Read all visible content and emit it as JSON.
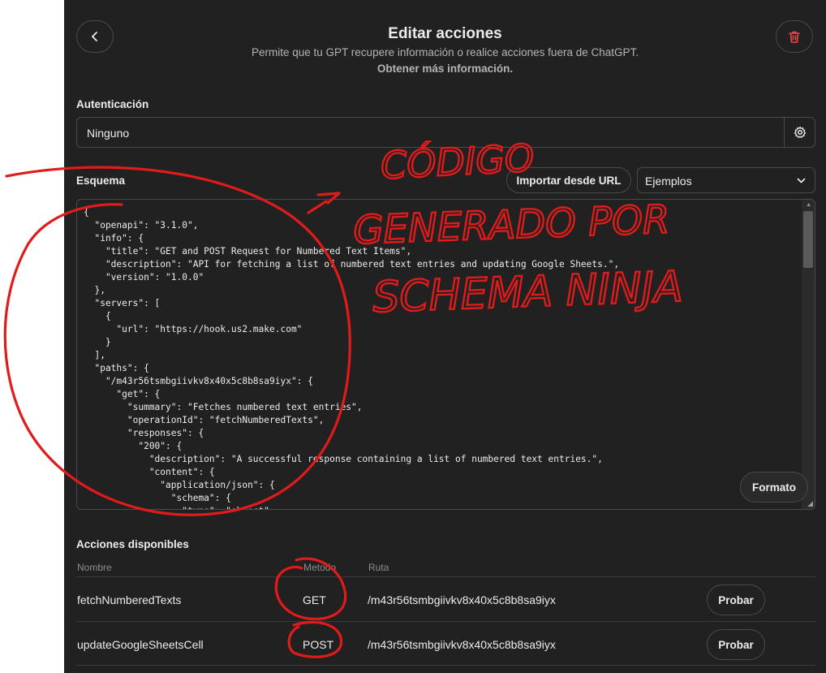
{
  "header": {
    "title": "Editar acciones",
    "subtitle": "Permite que tu GPT recupere información o realice acciones fuera de ChatGPT.",
    "link": "Obtener más información."
  },
  "auth": {
    "label": "Autenticación",
    "value": "Ninguno"
  },
  "schema": {
    "label": "Esquema",
    "import_label": "Importar desde URL",
    "examples_label": "Ejemplos",
    "format_label": "Formato",
    "code": "{\n  \"openapi\": \"3.1.0\",\n  \"info\": {\n    \"title\": \"GET and POST Request for Numbered Text Items\",\n    \"description\": \"API for fetching a list of numbered text entries and updating Google Sheets.\",\n    \"version\": \"1.0.0\"\n  },\n  \"servers\": [\n    {\n      \"url\": \"https://hook.us2.make.com\"\n    }\n  ],\n  \"paths\": {\n    \"/m43r56tsmbgiivkv8x40x5c8b8sa9iyx\": {\n      \"get\": {\n        \"summary\": \"Fetches numbered text entries\",\n        \"operationId\": \"fetchNumberedTexts\",\n        \"responses\": {\n          \"200\": {\n            \"description\": \"A successful response containing a list of numbered text entries.\",\n            \"content\": {\n              \"application/json\": {\n                \"schema\": {\n                  \"type\": \"object\","
  },
  "actions": {
    "label": "Acciones disponibles",
    "columns": {
      "name": "Nombre",
      "method": "Metodo",
      "path": "Ruta"
    },
    "rows": [
      {
        "name": "fetchNumberedTexts",
        "method": "GET",
        "path": "/m43r56tsmbgiivkv8x40x5c8b8sa9iyx",
        "try_label": "Probar"
      },
      {
        "name": "updateGoogleSheetsCell",
        "method": "POST",
        "path": "/m43r56tsmbgiivkv8x40x5c8b8sa9iyx",
        "try_label": "Probar"
      }
    ]
  },
  "annotations": {
    "line1": "CÓDIGO",
    "line2": "GENERADO POR",
    "line3": "SCHEMA NINJA",
    "ink_color": "#e01b1b"
  },
  "icons": {
    "back": "chevron-left-icon",
    "delete": "trash-icon",
    "settings": "gear-icon",
    "dropdown": "chevron-down-icon"
  },
  "colors": {
    "background": "#212121",
    "border": "#4a4a4a",
    "text": "#ececec",
    "muted": "#b4b4b4",
    "danger": "#ef4444"
  }
}
